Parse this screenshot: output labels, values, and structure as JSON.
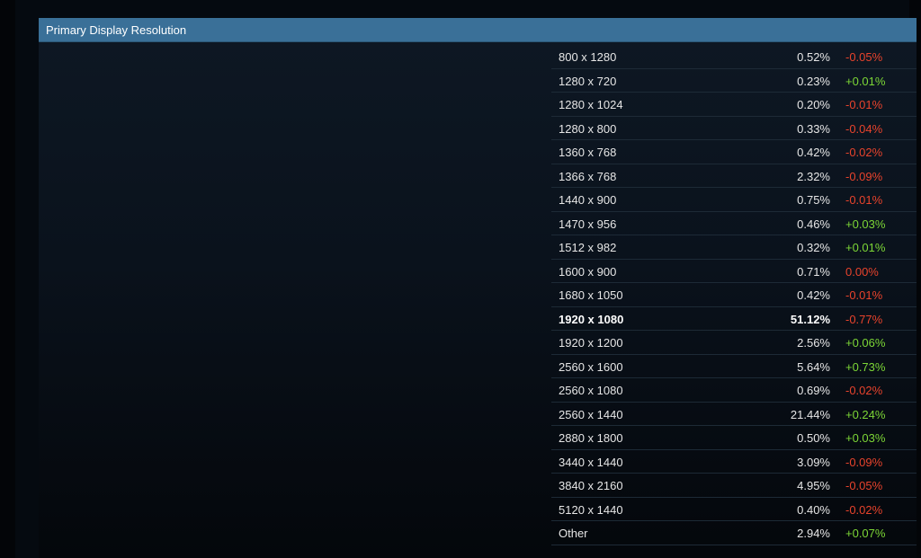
{
  "panel": {
    "title": "Primary Display Resolution"
  },
  "colors": {
    "header_bg": "#3a7098",
    "negative": "#e8432c",
    "positive": "#7cd636"
  },
  "rows": [
    {
      "resolution": "800 x 1280",
      "percent": "0.52%",
      "change": "-0.05%",
      "trend": "neg"
    },
    {
      "resolution": "1280 x 720",
      "percent": "0.23%",
      "change": "+0.01%",
      "trend": "pos"
    },
    {
      "resolution": "1280 x 1024",
      "percent": "0.20%",
      "change": "-0.01%",
      "trend": "neg"
    },
    {
      "resolution": "1280 x 800",
      "percent": "0.33%",
      "change": "-0.04%",
      "trend": "neg"
    },
    {
      "resolution": "1360 x 768",
      "percent": "0.42%",
      "change": "-0.02%",
      "trend": "neg"
    },
    {
      "resolution": "1366 x 768",
      "percent": "2.32%",
      "change": "-0.09%",
      "trend": "neg"
    },
    {
      "resolution": "1440 x 900",
      "percent": "0.75%",
      "change": "-0.01%",
      "trend": "neg"
    },
    {
      "resolution": "1470 x 956",
      "percent": "0.46%",
      "change": "+0.03%",
      "trend": "pos"
    },
    {
      "resolution": "1512 x 982",
      "percent": "0.32%",
      "change": "+0.01%",
      "trend": "pos"
    },
    {
      "resolution": "1600 x 900",
      "percent": "0.71%",
      "change": "0.00%",
      "trend": "neg"
    },
    {
      "resolution": "1680 x 1050",
      "percent": "0.42%",
      "change": "-0.01%",
      "trend": "neg"
    },
    {
      "resolution": "1920 x 1080",
      "percent": "51.12%",
      "change": "-0.77%",
      "trend": "neg",
      "bold": true
    },
    {
      "resolution": "1920 x 1200",
      "percent": "2.56%",
      "change": "+0.06%",
      "trend": "pos"
    },
    {
      "resolution": "2560 x 1600",
      "percent": "5.64%",
      "change": "+0.73%",
      "trend": "pos"
    },
    {
      "resolution": "2560 x 1080",
      "percent": "0.69%",
      "change": "-0.02%",
      "trend": "neg"
    },
    {
      "resolution": "2560 x 1440",
      "percent": "21.44%",
      "change": "+0.24%",
      "trend": "pos"
    },
    {
      "resolution": "2880 x 1800",
      "percent": "0.50%",
      "change": "+0.03%",
      "trend": "pos"
    },
    {
      "resolution": "3440 x 1440",
      "percent": "3.09%",
      "change": "-0.09%",
      "trend": "neg"
    },
    {
      "resolution": "3840 x 2160",
      "percent": "4.95%",
      "change": "-0.05%",
      "trend": "neg"
    },
    {
      "resolution": "5120 x 1440",
      "percent": "0.40%",
      "change": "-0.02%",
      "trend": "neg"
    },
    {
      "resolution": "Other",
      "percent": "2.94%",
      "change": "+0.07%",
      "trend": "pos"
    }
  ]
}
